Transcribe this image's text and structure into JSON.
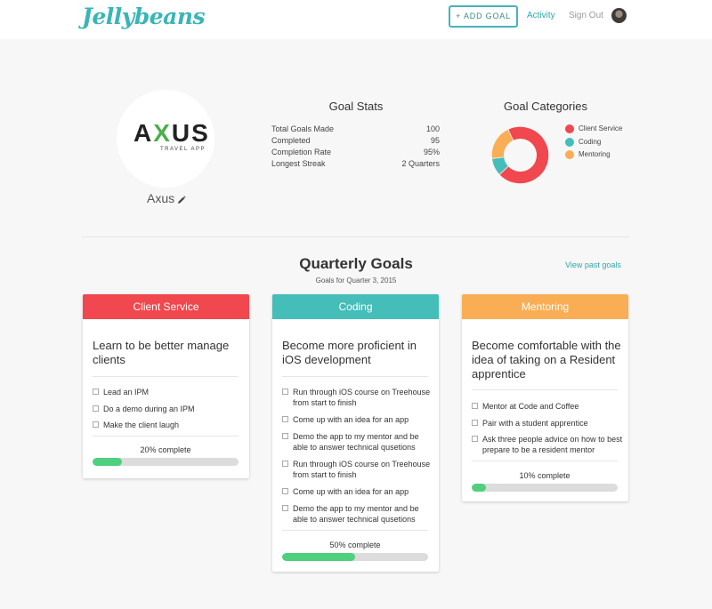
{
  "app": {
    "logo": "Jellybeans"
  },
  "nav": {
    "add_goal": "+ ADD GOAL",
    "activity": "Activity",
    "sign_out": "Sign Out"
  },
  "profile": {
    "logo_text_a": "A",
    "logo_text_x": "X",
    "logo_text_us": "US",
    "logo_sub": "TRAVEL APP",
    "name": "Axus"
  },
  "stats": {
    "title": "Goal Stats",
    "rows": [
      {
        "label": "Total Goals Made",
        "value": "100"
      },
      {
        "label": "Completed",
        "value": "95"
      },
      {
        "label": "Completion Rate",
        "value": "95%"
      },
      {
        "label": "Longest Streak",
        "value": "2 Quarters"
      }
    ]
  },
  "categories": {
    "title": "Goal Categories",
    "items": [
      {
        "label": "Client Service",
        "color": "#f0484e",
        "share": 0.7
      },
      {
        "label": "Coding",
        "color": "#45bdb9",
        "share": 0.1
      },
      {
        "label": "Mentoring",
        "color": "#f9ae55",
        "share": 0.2
      }
    ]
  },
  "quarterly": {
    "title": "Quarterly Goals",
    "subtitle": "Goals for Quarter 3, 2015",
    "view_past": "View past goals"
  },
  "cards": [
    {
      "category": "Client Service",
      "color": "#f0484e",
      "title": "Learn to be better manage clients",
      "tasks": [
        "Lead an IPM",
        "Do a demo during an IPM",
        "Make the client laugh"
      ],
      "progress_label": "20% complete",
      "progress": 0.2
    },
    {
      "category": "Coding",
      "color": "#45bdb9",
      "title": "Become more proficient in iOS development",
      "tasks": [
        "Run through iOS course on Treehouse from start to finish",
        "Come up with an idea for an app",
        "Demo the app to my mentor and be able to answer technical qusetions",
        "Run through iOS course on Treehouse from start to finish",
        "Come up with an idea for an app",
        "Demo the app to my mentor and be able to answer technical qusetions"
      ],
      "progress_label": "50% complete",
      "progress": 0.5
    },
    {
      "category": "Mentoring",
      "color": "#f9ae55",
      "title": "Become comfortable with the idea of taking on a Resident apprentice",
      "tasks": [
        "Mentor at Code and Coffee",
        "Pair with a student apprentice",
        "Ask three people advice on how to best prepare to be a resident mentor"
      ],
      "progress_label": "10% complete",
      "progress": 0.1
    }
  ]
}
